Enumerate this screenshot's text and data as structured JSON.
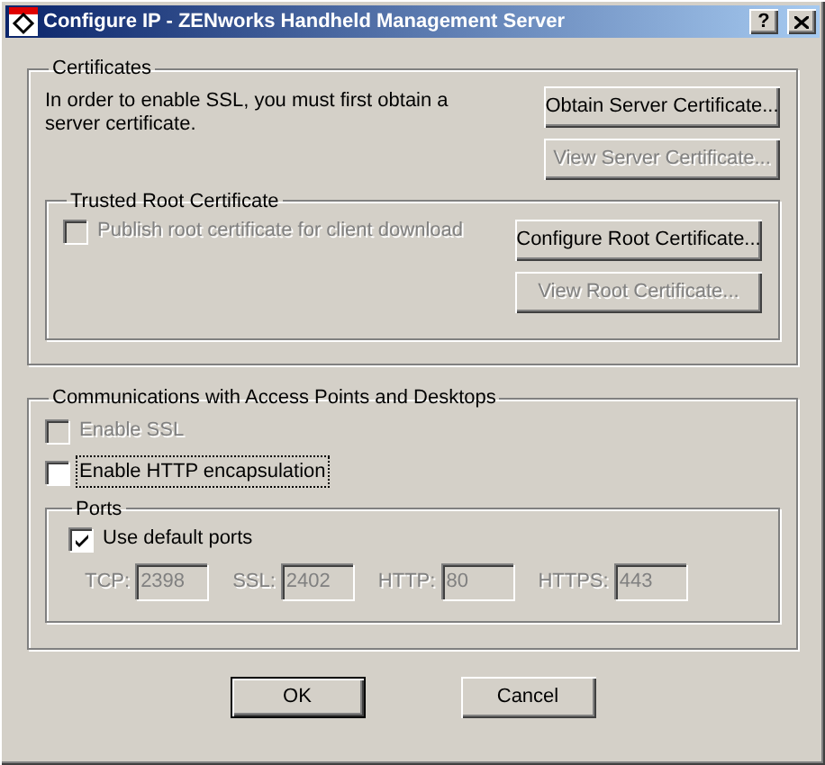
{
  "window": {
    "title": "Configure IP - ZENworks Handheld Management Server",
    "help": "?"
  },
  "certificates": {
    "title": "Certificates",
    "description": "In order to enable SSL, you must first obtain a server certificate.",
    "buttons": [
      {
        "label": "Obtain Server Certificate...",
        "disabled": false
      },
      {
        "label": "View Server Certificate...",
        "disabled": true
      }
    ],
    "trusted_root": {
      "title": "Trusted Root Certificate",
      "publish": {
        "label": "Publish root certificate for client download",
        "checked": false,
        "disabled": true
      },
      "buttons": [
        {
          "label": "Configure Root Certificate...",
          "disabled": false
        },
        {
          "label": "View Root Certificate...",
          "disabled": true
        }
      ]
    }
  },
  "communications": {
    "title": "Communications with Access Points and Desktops",
    "options": [
      {
        "label": "Enable SSL",
        "checked": false,
        "disabled": true,
        "focused": false
      },
      {
        "label": "Enable HTTP encapsulation",
        "checked": false,
        "disabled": false,
        "focused": true
      }
    ],
    "ports": {
      "title": "Ports",
      "use_default": {
        "label": "Use default ports",
        "checked": true,
        "disabled": false
      },
      "fields": [
        {
          "label": "TCP:",
          "value": "2398",
          "disabled": true
        },
        {
          "label": "SSL:",
          "value": "2402",
          "disabled": true
        },
        {
          "label": "HTTP:",
          "value": "80",
          "disabled": true
        },
        {
          "label": "HTTPS:",
          "value": "443",
          "disabled": true
        }
      ]
    }
  },
  "buttons": [
    {
      "label": "OK",
      "default": true
    },
    {
      "label": "Cancel",
      "default": false
    }
  ]
}
